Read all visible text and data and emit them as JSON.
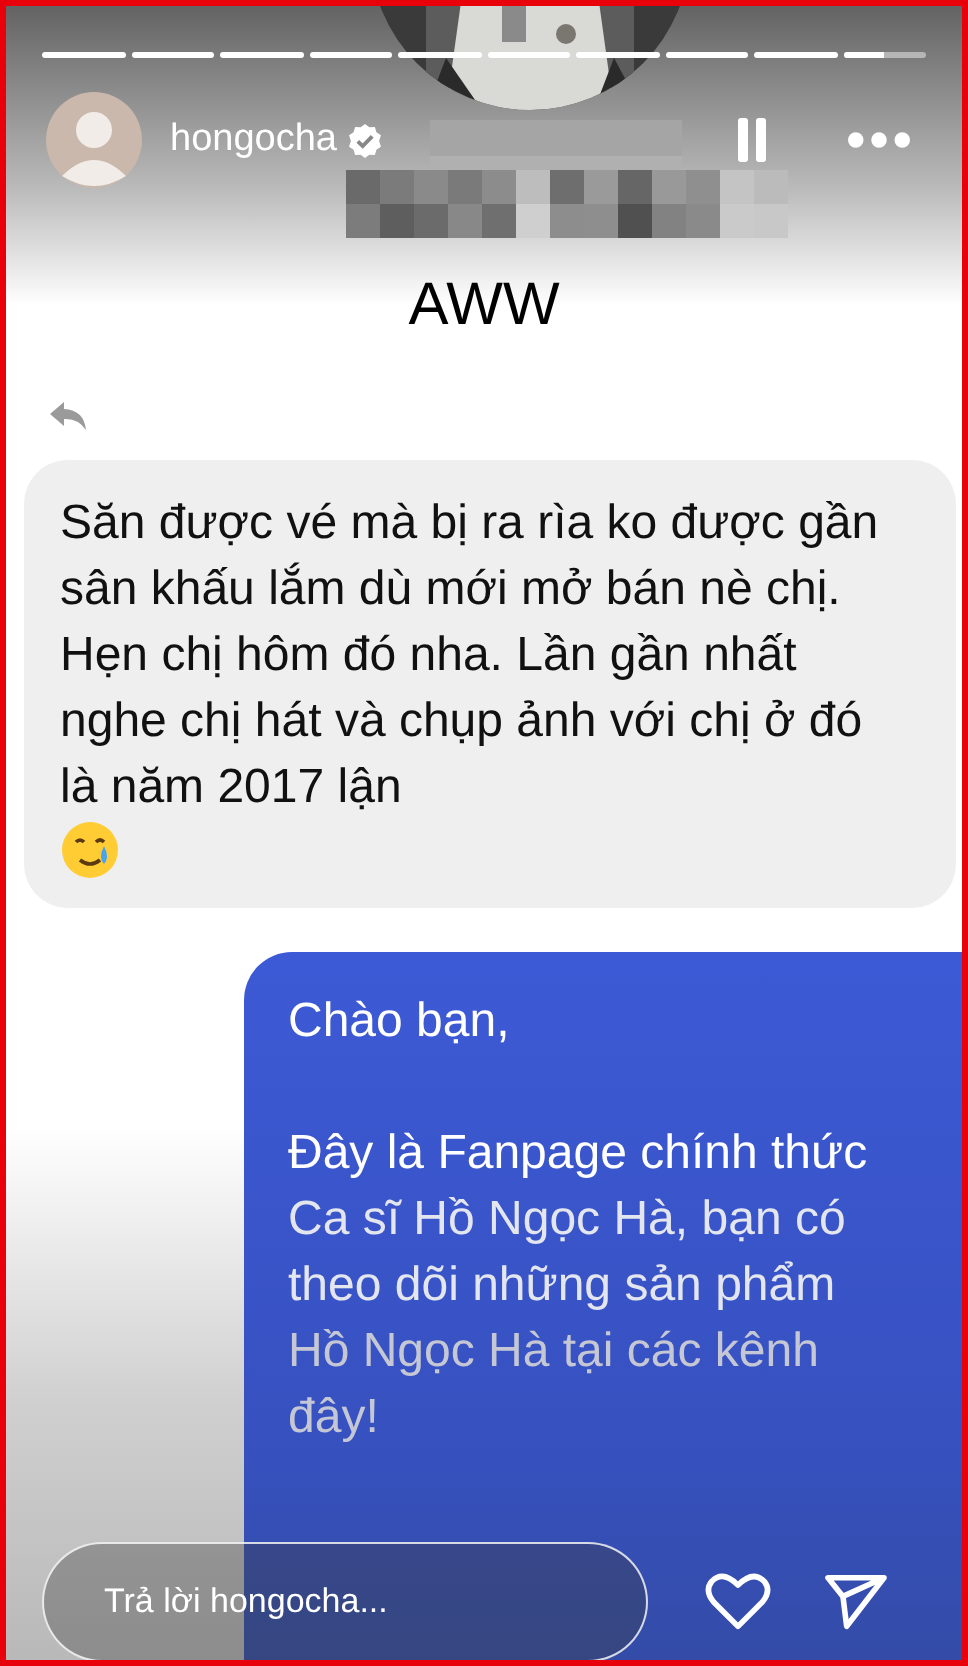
{
  "story": {
    "progress": [
      {
        "level": 1
      },
      {
        "level": 1
      },
      {
        "level": 1
      },
      {
        "level": 1
      },
      {
        "level": 1
      },
      {
        "level": 1
      },
      {
        "level": 1
      },
      {
        "level": 1
      },
      {
        "level": 1
      },
      {
        "level": 0.5
      }
    ],
    "username": "hongocha",
    "verified": true
  },
  "title": "AWW",
  "messages": [
    {
      "kind": "received",
      "text": "Săn được vé mà bị ra rìa ko được gần sân khấu lắm dù mới mở bán nè chị. Hẹn chị hôm đó nha. Lần gần nhất nghe chị hát và chụp ảnh với chị ở đó là năm 2017 lận",
      "emoji": true
    },
    {
      "kind": "sent",
      "paragraphs": [
        [
          "Chào bạn,"
        ],
        [
          "Đây là Fanpage chính thức",
          "Ca sĩ Hồ Ngọc Hà, bạn có",
          "theo dõi những sản phẩm",
          "Hồ Ngọc Hà tại các kênh",
          "đây!"
        ]
      ]
    }
  ],
  "reply": {
    "placeholder": "Trả lời hongocha..."
  }
}
